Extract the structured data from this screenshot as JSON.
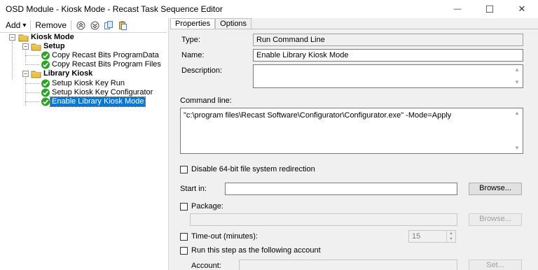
{
  "window": {
    "title": "OSD Module - Kiosk Mode - Recast Task Sequence Editor",
    "minimize_glyph": "—",
    "maximize_glyph": "☐",
    "close_glyph": "✕"
  },
  "toolbar": {
    "add_label": "Add",
    "add_arrow": "▾",
    "remove_label": "Remove",
    "icons": [
      "move-up-icon",
      "move-down-icon",
      "copy-icon",
      "paste-icon"
    ]
  },
  "tree": {
    "root": {
      "label": "Kiosk Mode"
    },
    "groups": [
      {
        "label": "Setup",
        "items": [
          {
            "label": "Copy Recast Bits ProgramData"
          },
          {
            "label": "Copy Recast Bits Program Files"
          }
        ]
      },
      {
        "label": "Library Kiosk",
        "items": [
          {
            "label": "Setup Kiosk Key Run"
          },
          {
            "label": "Setup Kiosk Key Configurator"
          },
          {
            "label": "Enable Library Kiosk Mode",
            "selected": true
          }
        ]
      }
    ]
  },
  "tabs": [
    "Properties",
    "Options"
  ],
  "properties": {
    "type_label": "Type:",
    "type_value": "Run Command Line",
    "name_label": "Name:",
    "name_value": "Enable Library Kiosk Mode",
    "description_label": "Description:",
    "description_value": "",
    "command_line_label": "Command line:",
    "command_line_value": "\"c:\\program files\\Recast Software\\Configurator\\Configurator.exe\" -Mode=Apply",
    "disable_64bit_label": "Disable 64-bit file system redirection",
    "start_in_label": "Start in:",
    "start_in_value": "",
    "browse_label": "Browse...",
    "package_label": "Package:",
    "package_value": "",
    "package_browse_label": "Browse...",
    "timeout_label": "Time-out (minutes):",
    "timeout_value": "15",
    "run_as_label": "Run this step as the following account",
    "account_label": "Account:",
    "account_value": "",
    "set_label": "Set..."
  },
  "colors": {
    "selection": "#0078d7",
    "success_green": "#2fa12b",
    "folder_yellow": "#e8c24a"
  }
}
